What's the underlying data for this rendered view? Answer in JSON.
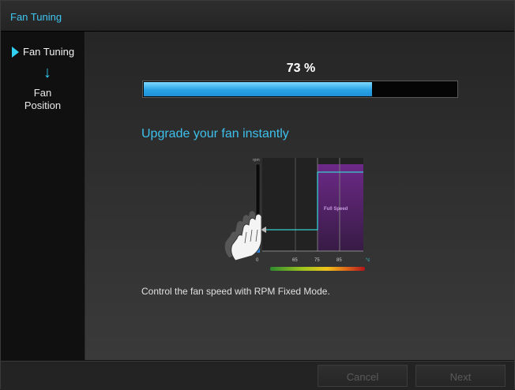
{
  "window": {
    "title": "Fan Tuning"
  },
  "sidebar": {
    "steps": [
      {
        "label": "Fan Tuning",
        "active": true,
        "icon": "play-icon"
      },
      {
        "label": "Fan Position",
        "line1": "Fan",
        "line2": "Position",
        "active": false
      }
    ],
    "connector_icon": "down-arrow-icon"
  },
  "progress": {
    "percent_label": "73 %",
    "value": 0.73,
    "color": "#2aa3e6"
  },
  "main": {
    "headline": "Upgrade your fan instantly",
    "description": "Control the fan speed with RPM Fixed Mode."
  },
  "illustration": {
    "y_label": "rpm",
    "x_unit": "°c",
    "x_ticks": [
      "0",
      "65",
      "75",
      "85"
    ],
    "zone_label": "Full Speed",
    "zone_color": "#7a2a9a",
    "line_color": "#35cfcf"
  },
  "footer": {
    "cancel_label": "Cancel",
    "next_label": "Next"
  }
}
